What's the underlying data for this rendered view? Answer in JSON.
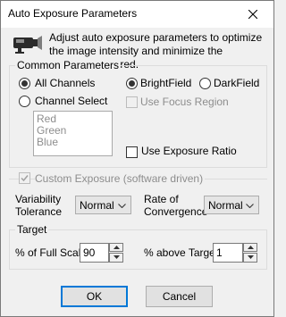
{
  "window": {
    "title": "Auto Exposure Parameters"
  },
  "intro": {
    "text": "Adjust auto exposure parameters to optimize the image intensity and minimize the exposure required."
  },
  "common": {
    "legend": "Common Parameters",
    "all_channels": "All Channels",
    "channel_select": "Channel Select",
    "channels": [
      "Red",
      "Green",
      "Blue"
    ],
    "brightfield": "BrightField",
    "darkfield": "DarkField",
    "use_focus_region": "Use Focus Region",
    "use_exposure_ratio": "Use Exposure Ratio"
  },
  "custom": {
    "checkbox_label": "Custom Exposure (software driven)",
    "variability_label": "Variability\nTolerance",
    "variability_value": "Normal",
    "rate_label": "Rate of\nConvergence",
    "rate_value": "Normal"
  },
  "target": {
    "legend": "Target",
    "full_scale_label": "% of Full Scale",
    "full_scale_value": "90",
    "above_target_label": "% above Target",
    "above_target_value": "1"
  },
  "buttons": {
    "ok": "OK",
    "cancel": "Cancel"
  },
  "icons": {
    "close": "close-icon",
    "camera": "camera-icon",
    "dropdown": "chevron-down-icon",
    "spin_up": "spin-up-icon",
    "spin_down": "spin-down-icon"
  }
}
